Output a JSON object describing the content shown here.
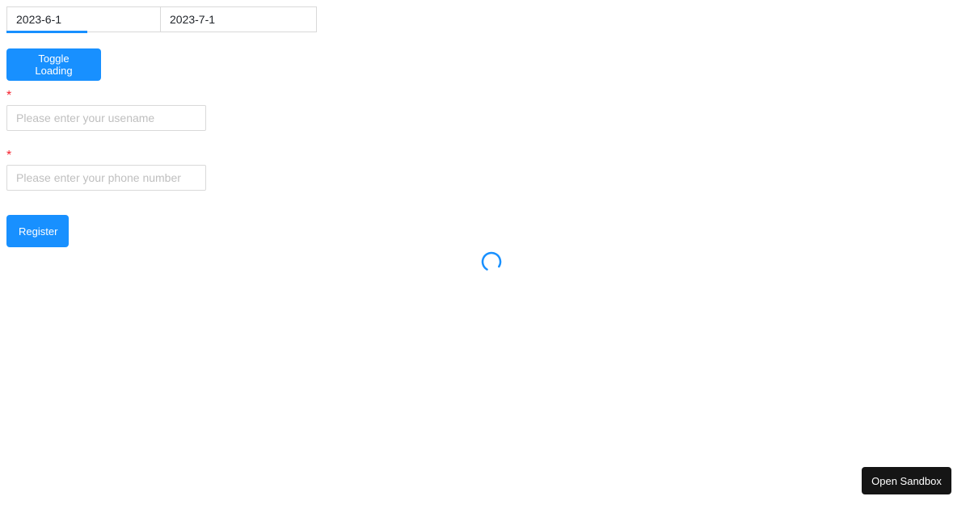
{
  "date_range": {
    "start_value": "2023-6-1",
    "end_value": "2023-7-1",
    "accent_color": "#1890ff"
  },
  "toggle_button": {
    "label": "Toggle Loading"
  },
  "form": {
    "required_mark": "*",
    "username": {
      "placeholder": "Please enter your usename",
      "value": ""
    },
    "phone": {
      "placeholder": "Please enter your phone number",
      "value": ""
    },
    "submit_label": "Register"
  },
  "loading": {
    "icon": "loading-spinner-icon",
    "color": "#1890ff"
  },
  "sandbox": {
    "label": "Open Sandbox"
  },
  "colors": {
    "primary": "#1890ff",
    "required": "#f5222d",
    "sandbox_bg": "#151515"
  }
}
